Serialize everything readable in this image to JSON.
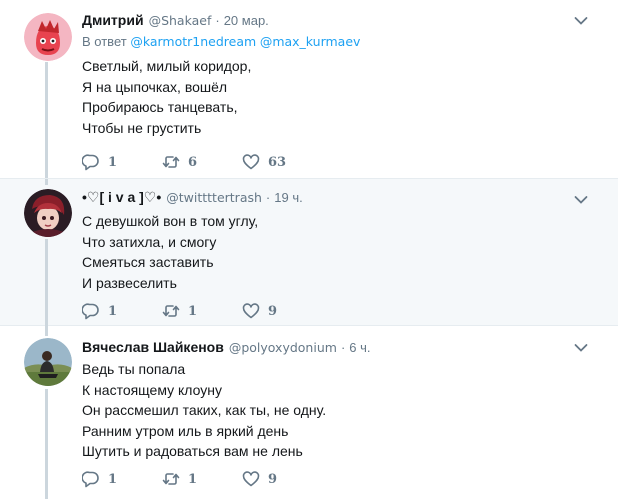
{
  "tweets": [
    {
      "name": "Дмитрий",
      "handle": "@Shakaef",
      "time": "20 мар.",
      "reply_label": "В ответ",
      "mentions": [
        "@karmotr1nedream",
        "@max_kurmaev"
      ],
      "lines": [
        "Светлый, милый коридор,",
        "Я на цыпочках, вошёл",
        "Пробираюсь танцевать,",
        "Чтобы не грустить"
      ],
      "replies": "1",
      "retweets": "6",
      "likes": "63"
    },
    {
      "name": "•♡[ i v a ]♡•",
      "handle": "@twittttertrash",
      "time": "19 ч.",
      "lines": [
        "С девушкой вон в том углу,",
        "Что затихла, и смогу",
        "Смеяться заставить",
        "И развеселить"
      ],
      "replies": "1",
      "retweets": "1",
      "likes": "9"
    },
    {
      "name": "Вячеслав Шайкенов",
      "handle": "@polyoxydonium",
      "time": "6 ч.",
      "lines": [
        "Ведь ты попала",
        "К настоящему клоуну",
        "Он рассмешил таких, как ты, не одну.",
        "Ранним утром иль в яркий день",
        "Шутить и радоваться вам не лень"
      ],
      "replies": "1",
      "retweets": "1",
      "likes": "9"
    }
  ],
  "separator": "·",
  "colors": {
    "link": "#1da1f2",
    "muted": "#657786",
    "text": "#14171a",
    "highlight_bg": "#f5f8fa"
  },
  "icons": [
    "reply-icon",
    "retweet-icon",
    "like-icon",
    "chevron-down-icon"
  ]
}
